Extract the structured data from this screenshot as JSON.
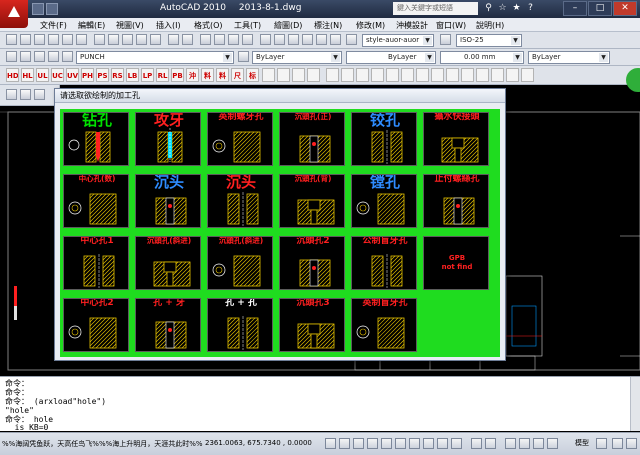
{
  "window": {
    "app_title": "AutoCAD 2010",
    "doc_title": "2013-8-1.dwg",
    "search_placeholder": "鍵入关鍵字或短語"
  },
  "menu": [
    "文件(F)",
    "編輯(E)",
    "視圖(V)",
    "插入(I)",
    "格式(O)",
    "工具(T)",
    "繪圖(D)",
    "標注(N)",
    "修改(M)",
    "沖模設計",
    "窗口(W)",
    "說明(H)"
  ],
  "toolbar": {
    "layer_name": "PUNCH",
    "text_style": "style-auor-auor",
    "dim_style": "ISO-25",
    "color": "ByLayer",
    "linetype": "ByLayer",
    "lineweight": "0.00 mm",
    "plot_style": "ByLayer"
  },
  "punch_toolbar_labels": [
    "HD",
    "HL",
    "UL",
    "UC",
    "UV",
    "PH",
    "PS",
    "RS",
    "LB",
    "LP",
    "RL",
    "PB",
    "沖",
    "料",
    "料",
    "尺",
    "标"
  ],
  "dialog": {
    "title": "请选取欲绘制的加工孔",
    "cells": [
      [
        {
          "label": "钻孔",
          "color": "#00e000",
          "icon": "drill-hole-icon"
        },
        {
          "label": "攻牙",
          "color": "#ff2020",
          "icon": "tap-thread-icon"
        },
        {
          "label": "英制螺牙孔",
          "color": "#ff2020",
          "icon": "imperial-thread-hole-icon"
        },
        {
          "label": "沉頭孔(正)",
          "color": "#ff2020",
          "icon": "counterbore-front-icon"
        },
        {
          "label": "铰孔",
          "color": "#2e8cff",
          "icon": "reamed-hole-icon"
        },
        {
          "label": "攝水快接頭",
          "color": "#ff2020",
          "icon": "water-quick-connector-icon"
        }
      ],
      [
        {
          "label": "中心孔(数)",
          "color": "#ff2020",
          "icon": "center-hole-count-icon"
        },
        {
          "label": "沉头",
          "color": "#2e8cff",
          "icon": "counterbore-blue-icon"
        },
        {
          "label": "沉头",
          "color": "#ff2020",
          "icon": "counterbore-red-icon"
        },
        {
          "label": "沉頭孔(背)",
          "color": "#ff2020",
          "icon": "counterbore-back-icon"
        },
        {
          "label": "镗孔",
          "color": "#2e8cff",
          "icon": "bored-hole-icon"
        },
        {
          "label": "止付螺絲孔",
          "color": "#ff2020",
          "icon": "set-screw-hole-icon"
        }
      ],
      [
        {
          "label": "中心孔1",
          "color": "#ff2020",
          "icon": "center-hole-1-icon"
        },
        {
          "label": "沉頭孔(斜进)",
          "color": "#ff2020",
          "icon": "counterbore-angled-icon"
        },
        {
          "label": "沉頭孔(斜进)",
          "color": "#ff2020",
          "icon": "counterbore-angled-2-icon"
        },
        {
          "label": "沉頭孔2",
          "color": "#ff2020",
          "icon": "counterbore-2-icon"
        },
        {
          "label": "公制盲牙孔",
          "color": "#ff2020",
          "icon": "metric-blind-thread-icon"
        },
        {
          "label": "",
          "color": "#ff2020",
          "icon": "missing-image-icon",
          "notfound": "GPB\nnot find"
        }
      ],
      [
        {
          "label": "中心孔2",
          "color": "#ff2020",
          "icon": "center-hole-2-icon"
        },
        {
          "label": "孔 + 牙",
          "color": "#ff2020",
          "icon": "hole-plus-thread-icon"
        },
        {
          "label": "孔 + 孔",
          "color": "#ffffff",
          "icon": "hole-plus-hole-icon"
        },
        {
          "label": "沉頭孔3",
          "color": "#ff2020",
          "icon": "counterbore-3-icon"
        },
        {
          "label": "英制盲牙孔",
          "color": "#ff2020",
          "icon": "imperial-blind-thread-icon"
        }
      ]
    ]
  },
  "command": {
    "lines": [
      "命令：",
      "命令：",
      "命令： (arxload\"hole\")",
      "\"hole\"",
      "命令： hole",
      "  is_KB=0"
    ]
  },
  "status": {
    "tip": "%%海阔凭鱼跃，天高任鸟飞%%%海上升明月，天涯共此时%%",
    "coords": "2361.0063, 675.7340 , 0.0000",
    "model_tab": "模型"
  }
}
